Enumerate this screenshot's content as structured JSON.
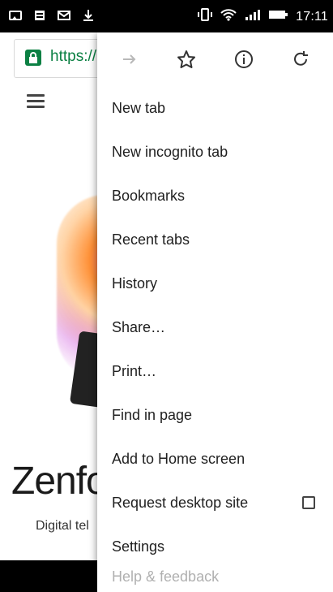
{
  "status_bar": {
    "time": "17:11",
    "left_icons": [
      "screen-cast-icon",
      "document-icon",
      "mail-icon",
      "download-icon"
    ],
    "right_icons": [
      "vibrate-icon",
      "wifi-icon",
      "signal-icon",
      "battery-icon"
    ]
  },
  "browser": {
    "url_text": "https://",
    "lock_icon": "lock-icon",
    "hamburger_icon": "hamburger-menu-icon"
  },
  "page": {
    "brand_title": "Zenfo",
    "brand_subtitle": "Digital tel"
  },
  "menu": {
    "top_buttons": [
      {
        "name": "forward-icon"
      },
      {
        "name": "star-icon"
      },
      {
        "name": "info-icon"
      },
      {
        "name": "refresh-icon"
      }
    ],
    "items": [
      {
        "label": "New tab"
      },
      {
        "label": "New incognito tab"
      },
      {
        "label": "Bookmarks"
      },
      {
        "label": "Recent tabs"
      },
      {
        "label": "History"
      },
      {
        "label": "Share…"
      },
      {
        "label": "Print…"
      },
      {
        "label": "Find in page"
      },
      {
        "label": "Add to Home screen"
      },
      {
        "label": "Request desktop site",
        "checkbox": false
      },
      {
        "label": "Settings"
      },
      {
        "label": "Help & feedback"
      }
    ]
  }
}
